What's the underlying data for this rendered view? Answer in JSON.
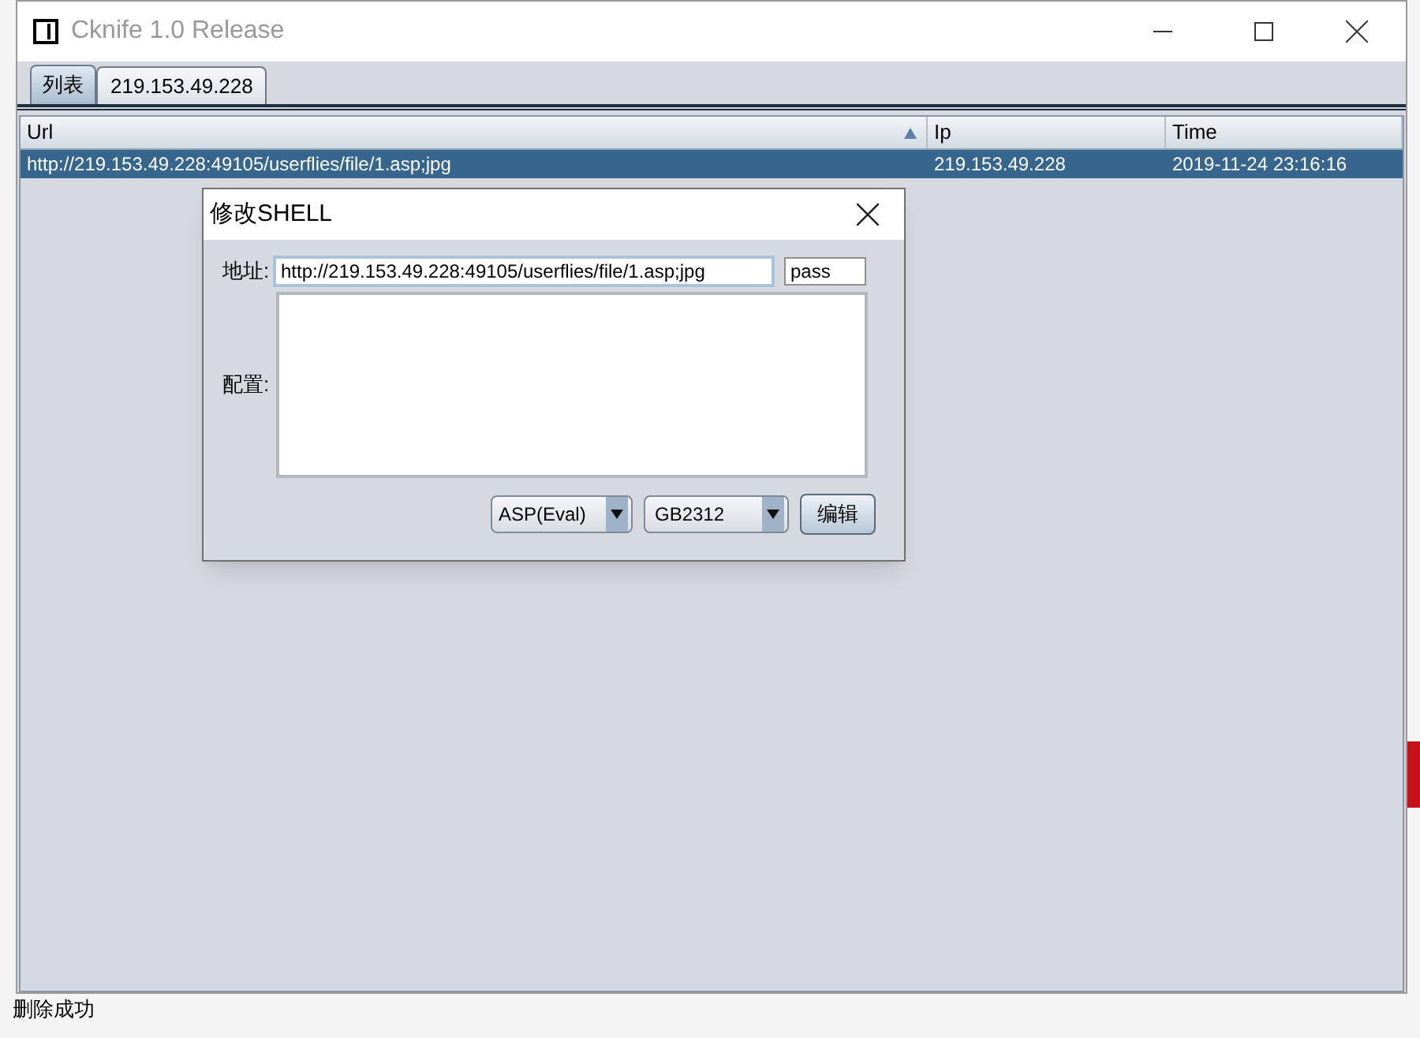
{
  "window": {
    "title": "Cknife 1.0 Release"
  },
  "tabs": [
    {
      "label": "列表",
      "selected": true
    },
    {
      "label": "219.153.49.228",
      "selected": false
    }
  ],
  "table": {
    "columns": [
      {
        "label": "Url",
        "sorted": true
      },
      {
        "label": "Ip",
        "sorted": false
      },
      {
        "label": "Time",
        "sorted": false
      }
    ],
    "rows": [
      {
        "cells": [
          "http://219.153.49.228:49105/userflies/file/1.asp;jpg",
          "219.153.49.228",
          "2019-11-24 23:16:16"
        ],
        "selected": true
      }
    ]
  },
  "dialog": {
    "title": "修改SHELL",
    "address_label": "地址:",
    "url": "http://219.153.49.228:49105/userflies/file/1.asp;jpg",
    "password": "pass",
    "config_label": "配置:",
    "type_select": "ASP(Eval)",
    "encoding_select": "GB2312",
    "button": "编辑"
  },
  "status_bar": "删除成功"
}
